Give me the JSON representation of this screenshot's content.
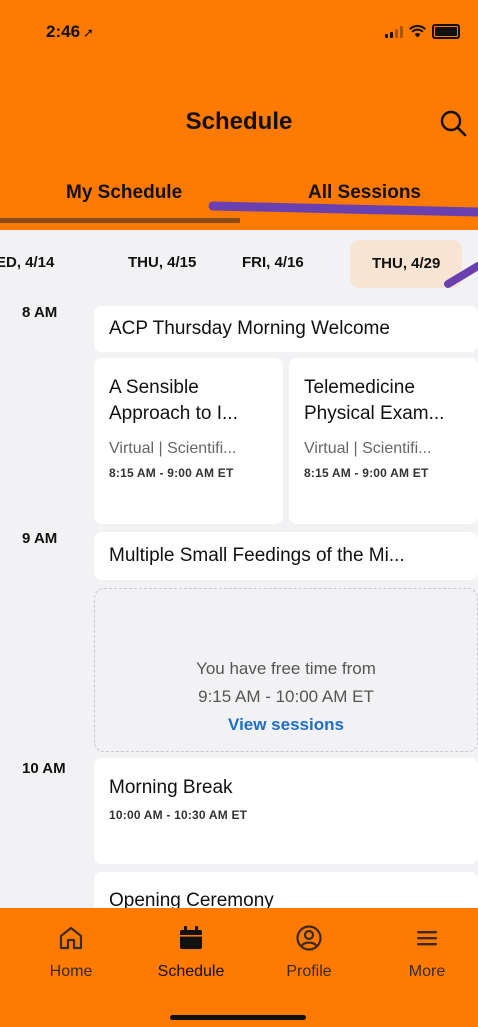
{
  "status_bar": {
    "time": "2:46",
    "location_arrow": "➚"
  },
  "header": {
    "title": "Schedule",
    "search_icon": "search-icon"
  },
  "tabs": [
    {
      "label": "My Schedule",
      "active": true
    },
    {
      "label": "All Sessions",
      "active": false
    }
  ],
  "dates": [
    {
      "label": "ED, 4/14",
      "active": false
    },
    {
      "label": "THU, 4/15",
      "active": false
    },
    {
      "label": "FRI, 4/16",
      "active": false
    },
    {
      "label": "THU, 4/29",
      "active": true
    }
  ],
  "timeline": {
    "times": [
      "8 AM",
      "9 AM",
      "10 AM"
    ]
  },
  "sessions": {
    "welcome": {
      "title": "ACP Thursday Morning Welcome"
    },
    "card1": {
      "title_line1": "A Sensible",
      "title_line2": "Approach to I...",
      "sub": "Virtual | Scientifi...",
      "time": "8:15 AM - 9:00 AM ET"
    },
    "card2": {
      "title_line1": "Telemedicine",
      "title_line2": "Physical Exam...",
      "sub": "Virtual | Scientifi...",
      "time": "8:15 AM - 9:00 AM ET"
    },
    "feedings": {
      "title": "Multiple Small Feedings of the Mi..."
    },
    "break": {
      "title": "Morning Break",
      "time": "10:00 AM - 10:30 AM ET"
    },
    "opening": {
      "title": "Opening Ceremony"
    }
  },
  "free_time": {
    "line1": "You have free time from",
    "line2": "9:15 AM - 10:00 AM ET",
    "link": "View sessions"
  },
  "bottom_nav": [
    {
      "label": "Home",
      "icon": "home-icon",
      "active": false
    },
    {
      "label": "Schedule",
      "icon": "calendar-icon",
      "active": true
    },
    {
      "label": "Profile",
      "icon": "profile-icon",
      "active": false
    },
    {
      "label": "More",
      "icon": "menu-icon",
      "active": false
    }
  ],
  "colors": {
    "brand": "#ff7a00",
    "link": "#1c6fc4",
    "underline": "#8a4b16",
    "annotation": "#6a3fb0"
  }
}
